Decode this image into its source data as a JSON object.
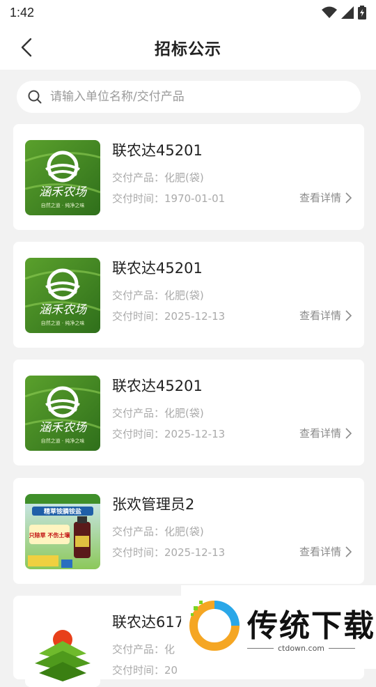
{
  "status_bar": {
    "time": "1:42"
  },
  "header": {
    "title": "招标公示"
  },
  "search": {
    "placeholder": "请输入单位名称/交付产品"
  },
  "items": [
    {
      "title": "联农达45201",
      "product": "交付产品：化肥(袋)",
      "time": "交付时间：1970-01-01",
      "detail_label": "查看详情",
      "image": "farm-logo",
      "image_text": "涵禾农场",
      "image_subtext": "自然之道 · 纯净之味"
    },
    {
      "title": "联农达45201",
      "product": "交付产品：化肥(袋)",
      "time": "交付时间：2025-12-13",
      "detail_label": "查看详情",
      "image": "farm-logo",
      "image_text": "涵禾农场",
      "image_subtext": "自然之道 · 纯净之味"
    },
    {
      "title": "联农达45201",
      "product": "交付产品：化肥(袋)",
      "time": "交付时间：2025-12-13",
      "detail_label": "查看详情",
      "image": "farm-logo",
      "image_text": "涵禾农场",
      "image_subtext": "自然之道 · 纯净之味"
    },
    {
      "title": "张欢管理员2",
      "product": "交付产品：化肥(袋)",
      "time": "交付时间：2025-12-13",
      "detail_label": "查看详情",
      "image": "product-ad",
      "image_text": "精草铵膦铵盐",
      "image_subtext": "只除草 不伤土壤"
    },
    {
      "title": "联农达617",
      "product": "交付产品：化",
      "time": "交付时间：20",
      "detail_label": "",
      "image": "green-book-logo"
    }
  ],
  "watermark": {
    "text": "传统下载",
    "url": "ctdown.com"
  },
  "colors": {
    "background": "#f2f2f2",
    "card": "#ffffff",
    "muted_text": "#aaaaaa"
  }
}
